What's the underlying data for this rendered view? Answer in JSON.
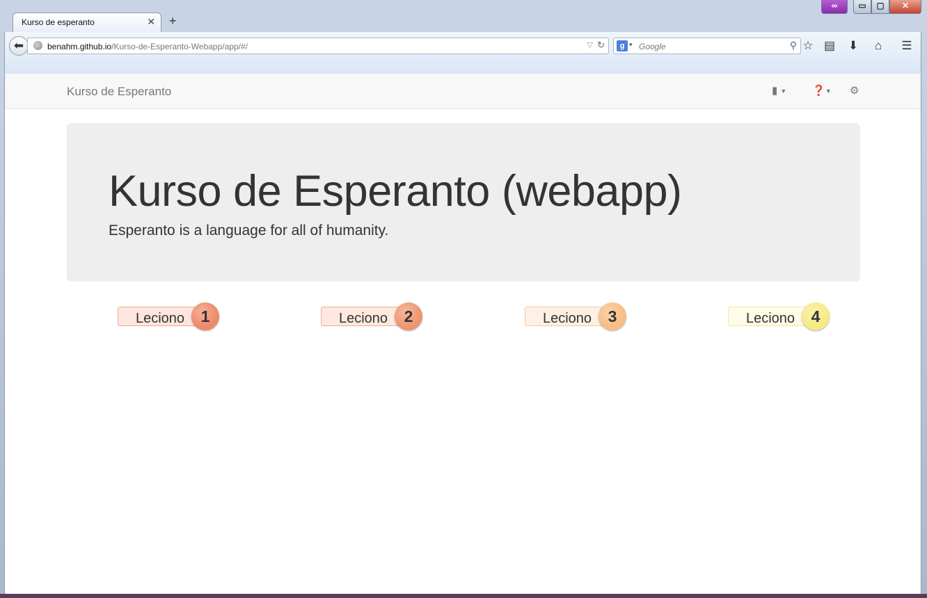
{
  "browser": {
    "tab_title": "Kurso de esperanto",
    "tab_close": "✕",
    "new_tab": "+",
    "url_host": "benahm.github.io",
    "url_path": "/Kurso-de-Esperanto-Webapp/app/#/",
    "search_engine_letter": "g",
    "search_placeholder": "Google",
    "controls": {
      "minimize": "▭",
      "maximize": "▢",
      "close": "✕"
    }
  },
  "navbar": {
    "brand": "Kurso de Esperanto",
    "icons": [
      "book-icon",
      "question-circle-icon",
      "gear-icon"
    ]
  },
  "jumbotron": {
    "title": "Kurso de Esperanto (webapp)",
    "subtitle": "Esperanto is a language for all of humanity."
  },
  "lessons": [
    {
      "label": "Leciono",
      "number": "1",
      "pill_bg": "#fde6df",
      "pill_border": "#f0a88f",
      "circle_bg": "#ee8a6a"
    },
    {
      "label": "Leciono",
      "number": "2",
      "pill_bg": "#fde9df",
      "pill_border": "#f0ae8f",
      "circle_bg": "#f0956f"
    },
    {
      "label": "Leciono",
      "number": "3",
      "pill_bg": "#fef1e3",
      "pill_border": "#f5c9a0",
      "circle_bg": "#f8bd84"
    },
    {
      "label": "Leciono",
      "number": "4",
      "pill_bg": "#fefbe6",
      "pill_border": "#f2e9a0",
      "circle_bg": "#f7ea84"
    }
  ]
}
